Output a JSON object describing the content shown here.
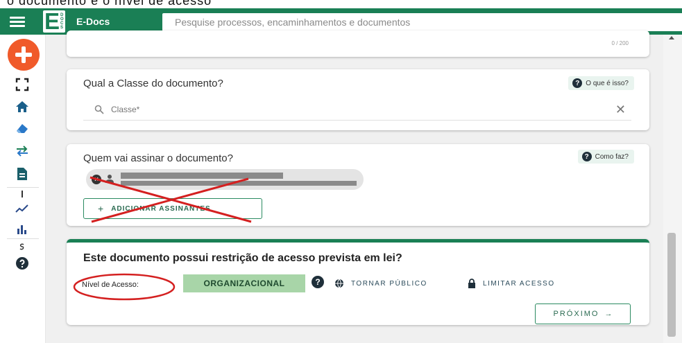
{
  "window": {
    "top_strip_text": "o documento e o nível de acesso"
  },
  "header": {
    "app_name": "E-Docs",
    "search_placeholder": "Pesquise processos, encaminhamentos e documentos",
    "accent_color": "#1a7f55"
  },
  "sidebar": {
    "fab_icon": "plus-icon",
    "items": [
      {
        "icon": "fullscreen-icon"
      },
      {
        "icon": "home-icon"
      },
      {
        "icon": "eraser-icon"
      },
      {
        "icon": "transfer-arrows-icon"
      },
      {
        "icon": "document-icon"
      },
      {
        "icon": "line-chart-icon"
      },
      {
        "icon": "bar-chart-icon"
      },
      {
        "icon": "help-icon"
      }
    ]
  },
  "top_card": {
    "counter": "0 / 200"
  },
  "classe_card": {
    "title": "Qual a Classe do documento?",
    "help_label": "O que é isso?",
    "input_placeholder": "Classe*"
  },
  "signers_card": {
    "title": "Quem vai assinar o documento?",
    "help_label": "Como faz?",
    "add_button_label": "ADICIONAR ASSINANTES"
  },
  "access_card": {
    "title": "Este documento possui restrição de acesso prevista em lei?",
    "level_label": "Nível de Acesso:",
    "level_value": "ORGANIZACIONAL",
    "public_label": "TORNAR PÚBLICO",
    "limit_label": "LIMITAR ACESSO",
    "next_label": "PRÓXIMO"
  }
}
